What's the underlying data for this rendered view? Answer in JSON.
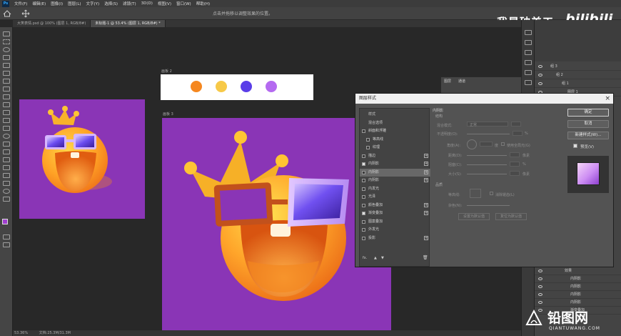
{
  "menubar": {
    "logo": "Ps",
    "items": [
      "文件(F)",
      "编辑(E)",
      "图像(I)",
      "图层(L)",
      "文字(Y)",
      "选择(S)",
      "滤镜(T)",
      "3D(D)",
      "视图(V)",
      "窗口(W)",
      "帮助(H)"
    ]
  },
  "optionsbar": {
    "hint": "点击并拖移以调整效果的位置。"
  },
  "brand": {
    "text": "我是破美工",
    "logo_text": "bilibili"
  },
  "tabs": [
    {
      "label": "大笑表情.psd @ 100% (图层 1, RGB/8#)"
    },
    {
      "label": "未标题-1 @ 53.4% (图层 1, RGB/8#) *"
    }
  ],
  "canvases": {
    "colors_label": "画板 2",
    "main_label": "画板 3",
    "swatches": [
      "#f5871f",
      "#f7c948",
      "#5a3ee8",
      "#b46af0"
    ]
  },
  "colors": {
    "art_bg": "#8a35b6"
  },
  "status": {
    "zoom": "53.36%",
    "doc": "文档:25.3M/31.3M"
  },
  "layers": {
    "top_items": [
      "组 3",
      "组 2",
      "组 1",
      "图层 1"
    ],
    "fx_label": "效果",
    "fx_items": [
      "内阴影",
      "内阴影",
      "内阴影",
      "内阴影",
      "渐变叠加"
    ]
  },
  "minipanel": {
    "tab1": "图层",
    "tab2": "通道"
  },
  "dialog": {
    "title": "图层样式",
    "close": "×",
    "effects": [
      {
        "label": "样式",
        "cb": null,
        "plus": false
      },
      {
        "label": "混合选项",
        "cb": null,
        "plus": false
      },
      {
        "label": "斜面和浮雕",
        "cb": false,
        "plus": false
      },
      {
        "label": "等高线",
        "cb": false,
        "plus": false,
        "sub": true
      },
      {
        "label": "纹理",
        "cb": false,
        "plus": false,
        "sub": true
      },
      {
        "label": "描边",
        "cb": false,
        "plus": true
      },
      {
        "label": "内阴影",
        "cb": true,
        "plus": true
      },
      {
        "label": "内阴影",
        "cb": false,
        "plus": true,
        "selected": true
      },
      {
        "label": "内阴影",
        "cb": false,
        "plus": true
      },
      {
        "label": "内发光",
        "cb": false,
        "plus": false
      },
      {
        "label": "光泽",
        "cb": false,
        "plus": false
      },
      {
        "label": "颜色叠加",
        "cb": false,
        "plus": true
      },
      {
        "label": "渐变叠加",
        "cb": true,
        "plus": true
      },
      {
        "label": "图案叠加",
        "cb": false,
        "plus": false
      },
      {
        "label": "外发光",
        "cb": false,
        "plus": false
      },
      {
        "label": "投影",
        "cb": false,
        "plus": true
      }
    ],
    "footer": {
      "fx": "fx.",
      "up": "▲",
      "down": "▼",
      "trash": "🗑"
    },
    "settings": {
      "section": "内阴影",
      "subsection": "结构",
      "blend_mode_label": "混合模式:",
      "blend_mode_value": "正常",
      "opacity_label": "不透明度(O):",
      "opacity_unit": "%",
      "angle_label": "角度(A):",
      "angle_unit": "度",
      "global_light": "使用全局光(G)",
      "distance_label": "距离(D):",
      "choke_label": "阻塞(C):",
      "size_label": "大小(S):",
      "px_unit": "像素",
      "percent_unit": "%",
      "quality_section": "品质",
      "contour_label": "等高线:",
      "antialias": "消除锯齿(L)",
      "noise_label": "杂色(N):",
      "default_btn": "设置为默认值",
      "reset_btn": "复位为默认值"
    },
    "buttons": {
      "ok": "确定",
      "cancel": "取消",
      "new_style": "新建样式(W)...",
      "preview": "预览(V)"
    }
  },
  "watermark": {
    "text": "铅图网",
    "url": "QIANTUWANG.COM"
  }
}
